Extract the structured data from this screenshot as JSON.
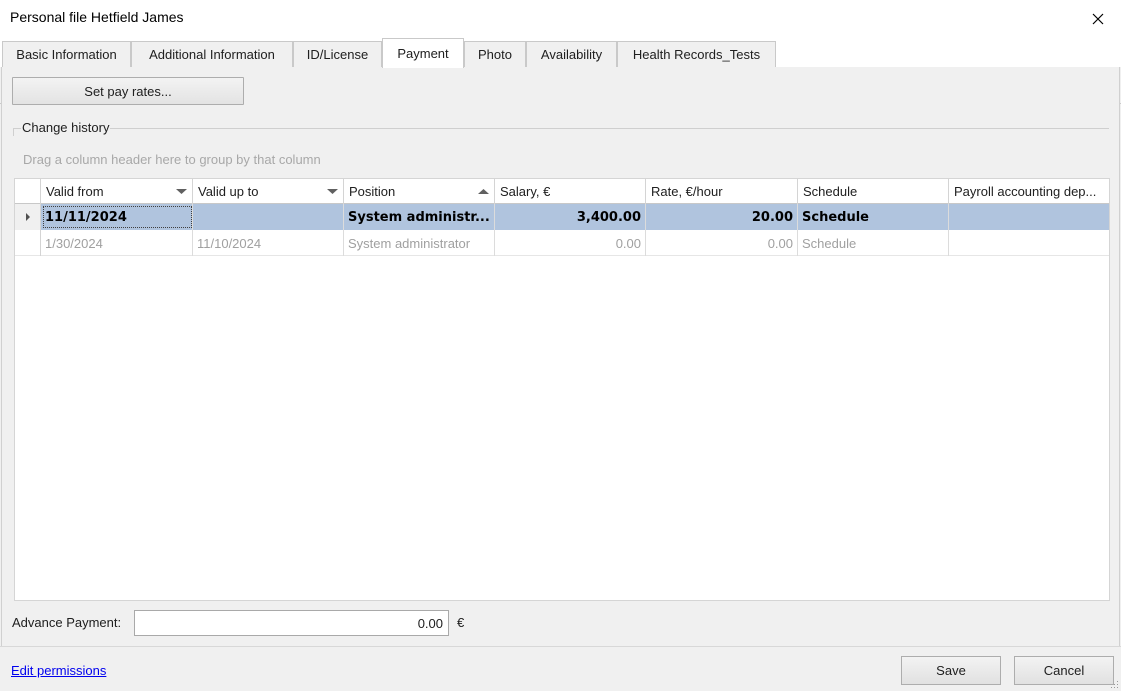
{
  "window": {
    "title": "Personal file Hetfield James"
  },
  "tabs": [
    {
      "label": "Basic Information",
      "active": false
    },
    {
      "label": "Additional Information",
      "active": false
    },
    {
      "label": "ID/License",
      "active": false
    },
    {
      "label": "Payment",
      "active": true
    },
    {
      "label": "Photo",
      "active": false
    },
    {
      "label": "Availability",
      "active": false
    },
    {
      "label": "Health Records_Tests",
      "active": false
    }
  ],
  "payment": {
    "set_pay_rates_label": "Set pay rates...",
    "group_title": "Change history",
    "group_hint": "Drag a column header here to group by that column",
    "columns": [
      {
        "label": "Valid from",
        "indicator": "dropdown"
      },
      {
        "label": "Valid up to",
        "indicator": "dropdown"
      },
      {
        "label": "Position",
        "indicator": "sort-ascending"
      },
      {
        "label": "Salary, €",
        "indicator": "none"
      },
      {
        "label": "Rate, €/hour",
        "indicator": "none"
      },
      {
        "label": "Schedule",
        "indicator": "none"
      },
      {
        "label": "Payroll accounting dep...",
        "indicator": "none"
      }
    ],
    "rows": [
      {
        "selected": true,
        "cells": [
          "11/11/2024",
          "",
          "System administr...",
          "3,400.00",
          "20.00",
          "Schedule",
          ""
        ]
      },
      {
        "selected": false,
        "cells": [
          "1/30/2024",
          "11/10/2024",
          "System administrator",
          "0.00",
          "0.00",
          "Schedule",
          ""
        ]
      }
    ],
    "advance_payment": {
      "label": "Advance Payment:",
      "value": "0.00",
      "unit": "€"
    }
  },
  "footer": {
    "edit_permissions_label": "Edit permissions",
    "save_label": "Save",
    "cancel_label": "Cancel"
  },
  "colors": {
    "selected_row": "#b0c4de",
    "link": "#0000ee",
    "dim_text": "#a0a0a0"
  }
}
